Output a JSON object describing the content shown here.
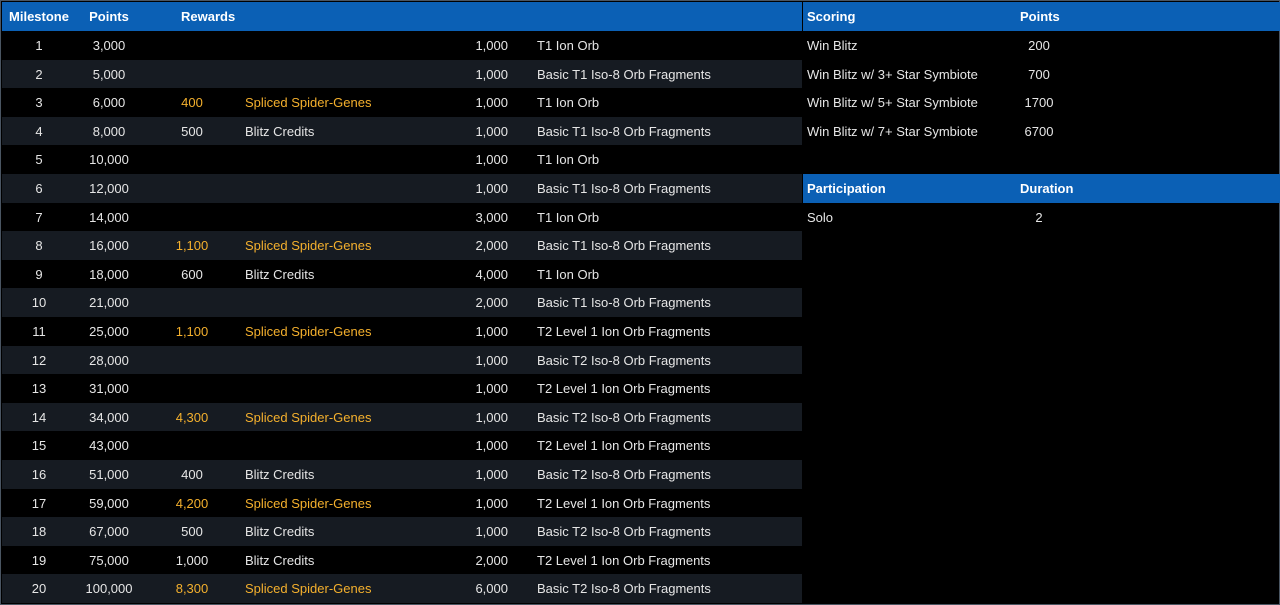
{
  "milestones": {
    "headers": {
      "milestone": "Milestone",
      "points": "Points",
      "rewards": "Rewards"
    },
    "rows": [
      {
        "milestone": "1",
        "points": "3,000",
        "reward_amount": "",
        "reward_name": "",
        "bonus_amount": "1,000",
        "bonus_name": "T1 Ion Orb",
        "highlight": false
      },
      {
        "milestone": "2",
        "points": "5,000",
        "reward_amount": "",
        "reward_name": "",
        "bonus_amount": "1,000",
        "bonus_name": "Basic T1 Iso-8 Orb Fragments",
        "highlight": false
      },
      {
        "milestone": "3",
        "points": "6,000",
        "reward_amount": "400",
        "reward_name": "Spliced Spider-Genes",
        "bonus_amount": "1,000",
        "bonus_name": "T1 Ion Orb",
        "highlight": true
      },
      {
        "milestone": "4",
        "points": "8,000",
        "reward_amount": "500",
        "reward_name": "Blitz Credits",
        "bonus_amount": "1,000",
        "bonus_name": "Basic T1 Iso-8 Orb Fragments",
        "highlight": false
      },
      {
        "milestone": "5",
        "points": "10,000",
        "reward_amount": "",
        "reward_name": "",
        "bonus_amount": "1,000",
        "bonus_name": "T1 Ion Orb",
        "highlight": false
      },
      {
        "milestone": "6",
        "points": "12,000",
        "reward_amount": "",
        "reward_name": "",
        "bonus_amount": "1,000",
        "bonus_name": "Basic T1 Iso-8 Orb Fragments",
        "highlight": false
      },
      {
        "milestone": "7",
        "points": "14,000",
        "reward_amount": "",
        "reward_name": "",
        "bonus_amount": "3,000",
        "bonus_name": "T1 Ion Orb",
        "highlight": false
      },
      {
        "milestone": "8",
        "points": "16,000",
        "reward_amount": "1,100",
        "reward_name": "Spliced Spider-Genes",
        "bonus_amount": "2,000",
        "bonus_name": "Basic T1 Iso-8 Orb Fragments",
        "highlight": true
      },
      {
        "milestone": "9",
        "points": "18,000",
        "reward_amount": "600",
        "reward_name": "Blitz Credits",
        "bonus_amount": "4,000",
        "bonus_name": "T1 Ion Orb",
        "highlight": false
      },
      {
        "milestone": "10",
        "points": "21,000",
        "reward_amount": "",
        "reward_name": "",
        "bonus_amount": "2,000",
        "bonus_name": "Basic T1 Iso-8 Orb Fragments",
        "highlight": false
      },
      {
        "milestone": "11",
        "points": "25,000",
        "reward_amount": "1,100",
        "reward_name": "Spliced Spider-Genes",
        "bonus_amount": "1,000",
        "bonus_name": "T2 Level 1 Ion Orb Fragments",
        "highlight": true
      },
      {
        "milestone": "12",
        "points": "28,000",
        "reward_amount": "",
        "reward_name": "",
        "bonus_amount": "1,000",
        "bonus_name": "Basic T2 Iso-8 Orb Fragments",
        "highlight": false
      },
      {
        "milestone": "13",
        "points": "31,000",
        "reward_amount": "",
        "reward_name": "",
        "bonus_amount": "1,000",
        "bonus_name": "T2 Level 1 Ion Orb Fragments",
        "highlight": false
      },
      {
        "milestone": "14",
        "points": "34,000",
        "reward_amount": "4,300",
        "reward_name": "Spliced Spider-Genes",
        "bonus_amount": "1,000",
        "bonus_name": "Basic T2 Iso-8 Orb Fragments",
        "highlight": true
      },
      {
        "milestone": "15",
        "points": "43,000",
        "reward_amount": "",
        "reward_name": "",
        "bonus_amount": "1,000",
        "bonus_name": "T2 Level 1 Ion Orb Fragments",
        "highlight": false
      },
      {
        "milestone": "16",
        "points": "51,000",
        "reward_amount": "400",
        "reward_name": "Blitz Credits",
        "bonus_amount": "1,000",
        "bonus_name": "Basic T2 Iso-8 Orb Fragments",
        "highlight": false
      },
      {
        "milestone": "17",
        "points": "59,000",
        "reward_amount": "4,200",
        "reward_name": "Spliced Spider-Genes",
        "bonus_amount": "1,000",
        "bonus_name": "T2 Level 1 Ion Orb Fragments",
        "highlight": true
      },
      {
        "milestone": "18",
        "points": "67,000",
        "reward_amount": "500",
        "reward_name": "Blitz Credits",
        "bonus_amount": "1,000",
        "bonus_name": "Basic T2 Iso-8 Orb Fragments",
        "highlight": false
      },
      {
        "milestone": "19",
        "points": "75,000",
        "reward_amount": "1,000",
        "reward_name": "Blitz Credits",
        "bonus_amount": "2,000",
        "bonus_name": "T2 Level 1 Ion Orb Fragments",
        "highlight": false
      },
      {
        "milestone": "20",
        "points": "100,000",
        "reward_amount": "8,300",
        "reward_name": "Spliced Spider-Genes",
        "bonus_amount": "6,000",
        "bonus_name": "Basic T2 Iso-8 Orb Fragments",
        "highlight": true
      }
    ]
  },
  "scoring": {
    "headers": {
      "label": "Scoring",
      "value": "Points"
    },
    "rows": [
      {
        "label": "Win Blitz",
        "value": "200"
      },
      {
        "label": "Win Blitz w/ 3+ Star Symbiote",
        "value": "700"
      },
      {
        "label": "Win Blitz w/ 5+ Star Symbiote",
        "value": "1700"
      },
      {
        "label": "Win Blitz w/ 7+ Star Symbiote",
        "value": "6700"
      }
    ]
  },
  "participation": {
    "headers": {
      "label": "Participation",
      "value": "Duration"
    },
    "rows": [
      {
        "label": "Solo",
        "value": "2"
      }
    ]
  },
  "colors": {
    "header_bg": "#0b60b5",
    "alt_row_bg": "#161b22",
    "highlight_text": "#f4b02d",
    "text": "#e6e6e6"
  }
}
